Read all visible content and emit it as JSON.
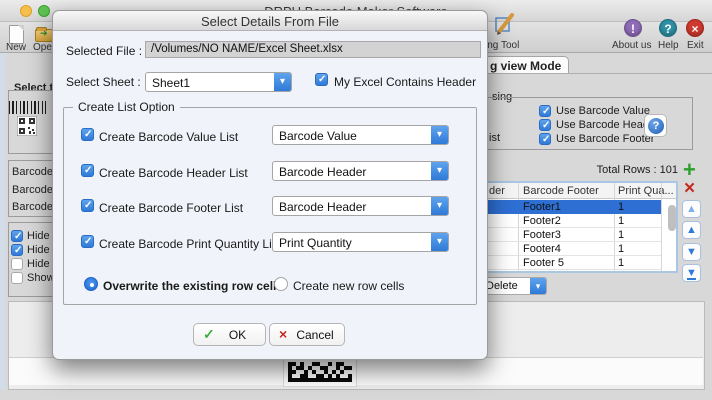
{
  "window": {
    "title": "DRPU Barcode Maker Software"
  },
  "toolbar": {
    "new_label": "New",
    "open_label": "Ope",
    "tool_label": "ing Tool",
    "about_label": "About us",
    "help_label": "Help",
    "exit_label": "Exit"
  },
  "background": {
    "view_mode_tab": "g view Mode",
    "left": {
      "select_type_label": "Select t",
      "barcode_rows": [
        "Barcode",
        "Barcode",
        "Barcode"
      ],
      "checkboxes": [
        {
          "label": "Hide",
          "checked": true
        },
        {
          "label": "Hide",
          "checked": true
        },
        {
          "label": "Hide",
          "checked": false
        },
        {
          "label": "Show",
          "checked": false
        }
      ]
    },
    "right": {
      "group_fragment": "sing",
      "list_fragment": "ist",
      "use_checkboxes": [
        {
          "label": "Use Barcode Value",
          "checked": true
        },
        {
          "label": "Use Barcode Header",
          "checked": true
        },
        {
          "label": "Use Barcode Footer",
          "checked": true
        }
      ],
      "total_rows": "Total Rows : 101",
      "table": {
        "columns": [
          "der",
          "Barcode Footer",
          "Print Qua..."
        ],
        "rows": [
          [
            "Footer1",
            "1"
          ],
          [
            "Footer2",
            "1"
          ],
          [
            "Footer3",
            "1"
          ],
          [
            "Footer4",
            "1"
          ],
          [
            "Footer 5",
            "1"
          ]
        ],
        "selected_row_index": 0
      },
      "delete_label": "Delete"
    }
  },
  "dialog": {
    "title": "Select Details From File",
    "selected_file_label": "Selected File :",
    "selected_file_value": "/Volumes/NO NAME/Excel Sheet.xlsx",
    "select_sheet_label": "Select Sheet :",
    "sheet_value": "Sheet1",
    "header_checkbox_label": "My Excel Contains Header",
    "header_checkbox_checked": true,
    "group_title": "Create List Option",
    "rows": [
      {
        "label": "Create Barcode Value List",
        "value": "Barcode Value",
        "checked": true
      },
      {
        "label": "Create Barcode Header List",
        "value": "Barcode Header",
        "checked": true
      },
      {
        "label": "Create Barcode Footer List",
        "value": "Barcode Header",
        "checked": true
      },
      {
        "label": "Create Barcode Print Quantity List",
        "value": "Print Quantity",
        "checked": true
      }
    ],
    "radio_options": [
      {
        "label": "Overwrite the existing row cells",
        "selected": true
      },
      {
        "label": "Create new row cells",
        "selected": false
      }
    ],
    "ok_label": "OK",
    "cancel_label": "Cancel"
  },
  "colors": {
    "accent_blue": "#2f7ad8",
    "selected_row_blue": "#2e6fd4",
    "ok_green": "#3fae3a",
    "cancel_red": "#c22a20",
    "about_purple": "#8e6bb5",
    "help_teal": "#2f8fa3",
    "exit_red": "#cf3a30"
  }
}
